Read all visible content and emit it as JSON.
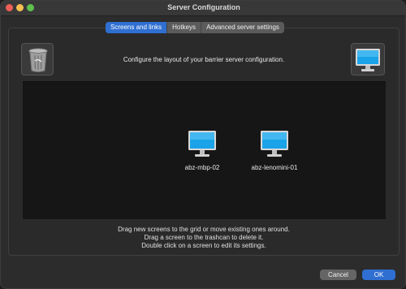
{
  "window": {
    "title": "Server Configuration"
  },
  "tabs": [
    {
      "label": "Screens and links",
      "active": true
    },
    {
      "label": "Hotkeys",
      "active": false
    },
    {
      "label": "Advanced server settings",
      "active": false
    }
  ],
  "instruction": "Configure the layout of your barrier server configuration.",
  "screens": [
    {
      "name": "abz-mbp-02",
      "icon": "monitor-icon"
    },
    {
      "name": "abz-lenomini-01",
      "icon": "monitor-icon"
    }
  ],
  "help": {
    "line1": "Drag new screens to the grid or move existing ones around.",
    "line2": "Drag a screen to the trashcan to delete it.",
    "line3": "Double click on a screen to edit its settings."
  },
  "buttons": {
    "cancel": "Cancel",
    "ok": "OK"
  },
  "colors": {
    "accent": "#2f6fd1",
    "window_bg": "#2c2c2c",
    "grid_bg": "#161616"
  }
}
